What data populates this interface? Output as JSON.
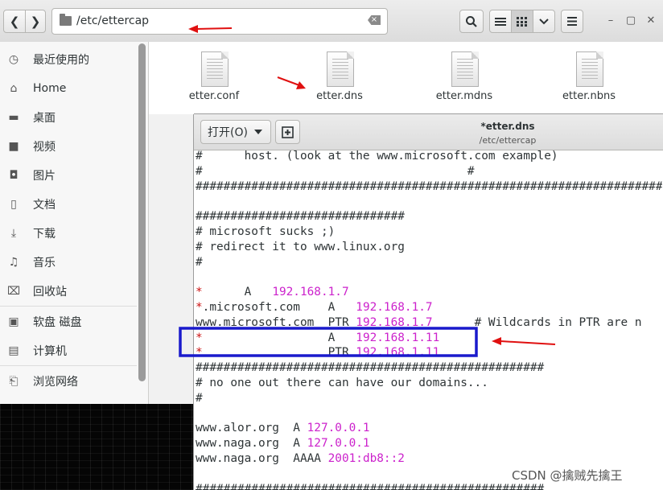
{
  "toolbar": {
    "back_icon": "chevron-left-icon",
    "forward_icon": "chevron-right-icon",
    "path": "/etc/ettercap",
    "search_icon": "search-icon",
    "list_view_icon": "list-icon",
    "grid_view_icon": "grid-icon",
    "view_options_icon": "chevron-down-icon",
    "menu_icon": "hamburger-icon",
    "window_controls": [
      "minimize-icon",
      "maximize-icon",
      "close-icon"
    ]
  },
  "sidebar": {
    "items": [
      {
        "label": "最近使用的",
        "icon": "clock-icon"
      },
      {
        "label": "Home",
        "icon": "home-icon"
      },
      {
        "label": "桌面",
        "icon": "folder-icon"
      },
      {
        "label": "视频",
        "icon": "video-icon"
      },
      {
        "label": "图片",
        "icon": "camera-icon"
      },
      {
        "label": "文档",
        "icon": "document-icon"
      },
      {
        "label": "下载",
        "icon": "download-icon"
      },
      {
        "label": "音乐",
        "icon": "music-icon"
      },
      {
        "label": "回收站",
        "icon": "trash-icon"
      },
      {
        "label": "软盘 磁盘",
        "icon": "disk-icon"
      },
      {
        "label": "计算机",
        "icon": "computer-icon"
      },
      {
        "label": "浏览网络",
        "icon": "network-icon"
      }
    ]
  },
  "files": [
    {
      "name": "etter.conf"
    },
    {
      "name": "etter.dns"
    },
    {
      "name": "etter.mdns"
    },
    {
      "name": "etter.nbns"
    }
  ],
  "editor": {
    "open_label": "打开(O)",
    "title": "*etter.dns",
    "subtitle": "/etc/ettercap",
    "lines": [
      {
        "a": "#      host. (look at the www.microsoft.com example)"
      },
      {
        "a": "#                                      #"
      },
      {
        "a": "##############################################################################"
      },
      {
        "a": ""
      },
      {
        "a": "##############################"
      },
      {
        "a": "# microsoft sucks ;)"
      },
      {
        "a": "# redirect it to www.linux.org"
      },
      {
        "a": "#"
      },
      {
        "a": ""
      },
      {
        "star": "*",
        "a": "      A   ",
        "ip": "192.168.1.7"
      },
      {
        "star": "*",
        "a": ".microsoft.com    A   ",
        "ip": "192.168.1.7"
      },
      {
        "a": "www.microsoft.com  PTR ",
        "ip": "192.168.1.7",
        "b": "      # Wildcards in PTR are n"
      },
      {
        "star": "*",
        "a": "                  A   ",
        "ip": "192.168.1.11"
      },
      {
        "star": "*",
        "a": "                  PTR ",
        "ip": "192.168.1.11"
      },
      {
        "a": "##################################################"
      },
      {
        "a": "# no one out there can have our domains..."
      },
      {
        "a": "#"
      },
      {
        "a": ""
      },
      {
        "a": "www.alor.org  A ",
        "ip": "127.0.0.1"
      },
      {
        "a": "www.naga.org  A ",
        "ip": "127.0.0.1"
      },
      {
        "a": "www.naga.org  AAAA ",
        "ip": "2001:db8::2"
      },
      {
        "a": ""
      },
      {
        "a": "##################################################"
      }
    ]
  },
  "watermark": "CSDN @擒贼先擒王",
  "annotation_color": "#e01010",
  "highlight_color": "#1a1acc"
}
